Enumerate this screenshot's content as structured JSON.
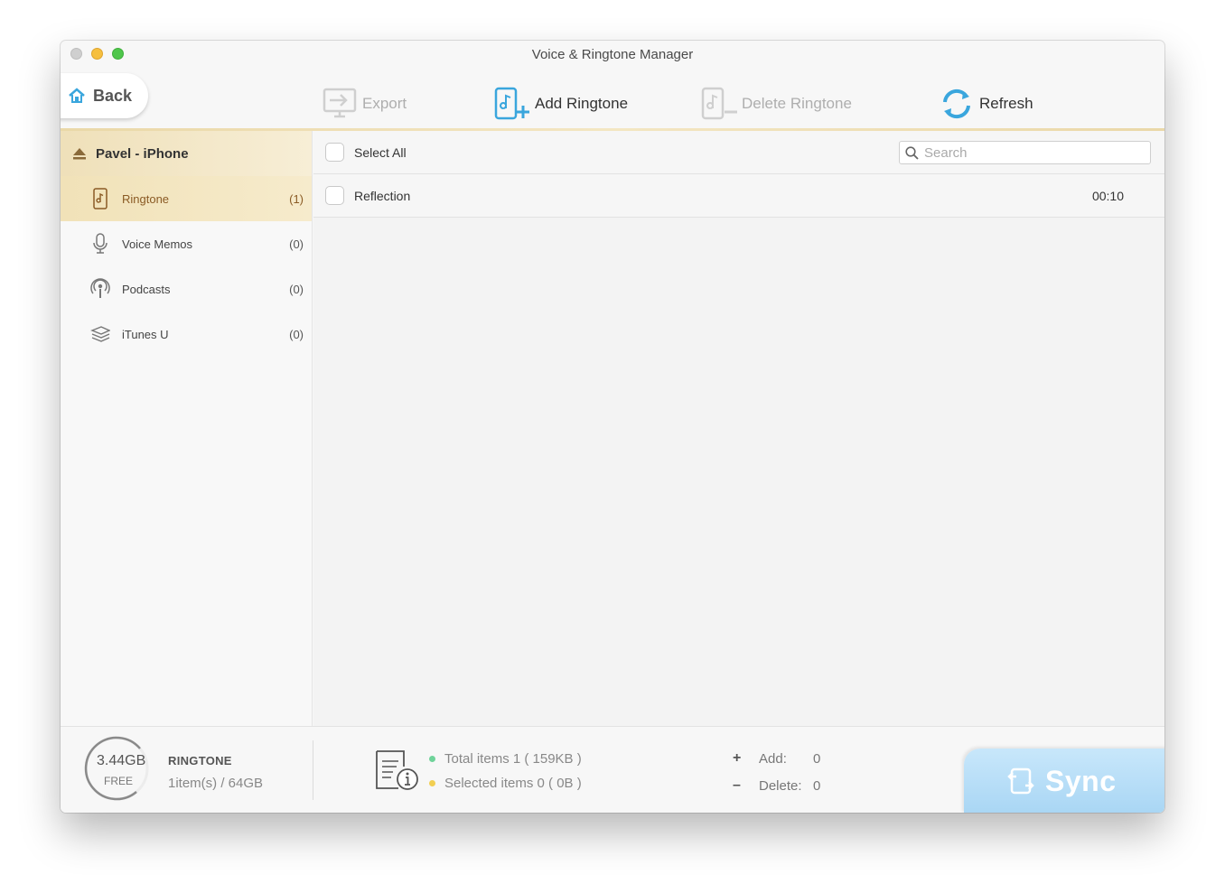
{
  "window": {
    "title": "Voice & Ringtone Manager"
  },
  "nav": {
    "back_label": "Back"
  },
  "toolbar": {
    "export_label": "Export",
    "add_label": "Add Ringtone",
    "delete_label": "Delete Ringtone",
    "refresh_label": "Refresh"
  },
  "sidebar": {
    "device_name": "Pavel - iPhone",
    "items": [
      {
        "label": "Ringtone",
        "count": "(1)",
        "icon": "ringtone-icon",
        "active": true
      },
      {
        "label": "Voice Memos",
        "count": "(0)",
        "icon": "microphone-icon",
        "active": false
      },
      {
        "label": "Podcasts",
        "count": "(0)",
        "icon": "podcast-icon",
        "active": false
      },
      {
        "label": "iTunes U",
        "count": "(0)",
        "icon": "itunes-u-icon",
        "active": false
      }
    ]
  },
  "list": {
    "select_all_label": "Select All",
    "search_placeholder": "Search",
    "rows": [
      {
        "title": "Reflection",
        "duration": "00:10"
      }
    ]
  },
  "footer": {
    "storage_free_value": "3.44GB",
    "storage_free_label": "FREE",
    "category_name": "RINGTONE",
    "category_usage": "1item(s) / 64GB",
    "total_items": "Total items 1 ( 159KB )",
    "selected_items": "Selected items 0 ( 0B )",
    "add_label": "Add:",
    "add_value": "0",
    "delete_label": "Delete:",
    "delete_value": "0",
    "sync_label": "Sync"
  },
  "colors": {
    "accent_gold": "#efe0b9",
    "active_text": "#8a5a24",
    "toolbar_blue": "#3aa6dd",
    "sync_blue": "#a9d6f4",
    "total_dot": "#6fd39a",
    "selected_dot": "#f2cf52"
  }
}
